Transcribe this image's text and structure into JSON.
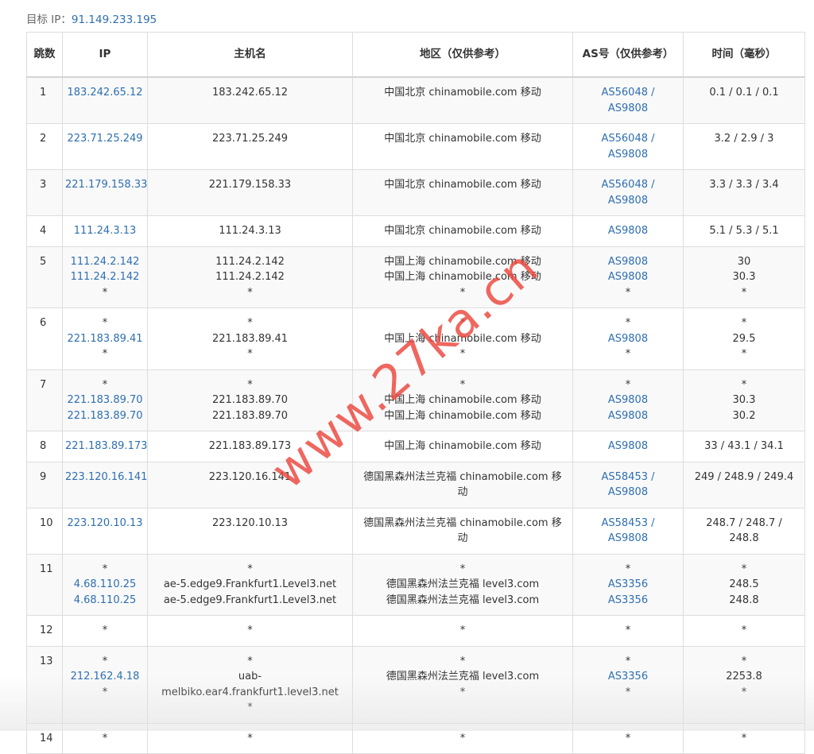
{
  "target": {
    "label": "目标 IP：",
    "ip": "91.149.233.195"
  },
  "headers": [
    "跳数",
    "IP",
    "主机名",
    "地区（仅供参考）",
    "AS号（仅供参考）",
    "时间（毫秒）"
  ],
  "rows": [
    {
      "hop": "1",
      "ip": [
        "183.242.65.12"
      ],
      "host": [
        "183.242.65.12"
      ],
      "region": [
        "中国北京 chinamobile.com 移动"
      ],
      "as": [
        "AS56048 /",
        "AS9808"
      ],
      "time": [
        "0.1 / 0.1 / 0.1"
      ]
    },
    {
      "hop": "2",
      "ip": [
        "223.71.25.249"
      ],
      "host": [
        "223.71.25.249"
      ],
      "region": [
        "中国北京 chinamobile.com 移动"
      ],
      "as": [
        "AS56048 /",
        "AS9808"
      ],
      "time": [
        "3.2 / 2.9 / 3"
      ]
    },
    {
      "hop": "3",
      "ip": [
        "221.179.158.33"
      ],
      "host": [
        "221.179.158.33"
      ],
      "region": [
        "中国北京 chinamobile.com 移动"
      ],
      "as": [
        "AS56048 /",
        "AS9808"
      ],
      "time": [
        "3.3 / 3.3 / 3.4"
      ]
    },
    {
      "hop": "4",
      "ip": [
        "111.24.3.13"
      ],
      "host": [
        "111.24.3.13"
      ],
      "region": [
        "中国北京 chinamobile.com 移动"
      ],
      "as": [
        "AS9808"
      ],
      "time": [
        "5.1 / 5.3 / 5.1"
      ]
    },
    {
      "hop": "5",
      "ip": [
        "111.24.2.142",
        "111.24.2.142",
        "*"
      ],
      "host": [
        "111.24.2.142",
        "111.24.2.142",
        "*"
      ],
      "region": [
        "中国上海 chinamobile.com 移动",
        "中国上海 chinamobile.com 移动",
        "*"
      ],
      "as": [
        "AS9808",
        "AS9808",
        "*"
      ],
      "time": [
        "30",
        "30.3",
        "*"
      ]
    },
    {
      "hop": "6",
      "ip": [
        "*",
        "221.183.89.41",
        "*"
      ],
      "host": [
        "*",
        "221.183.89.41",
        "*"
      ],
      "region": [
        "*",
        "中国上海 chinamobile.com 移动",
        "*"
      ],
      "as": [
        "*",
        "AS9808",
        "*"
      ],
      "time": [
        "*",
        "29.5",
        "*"
      ]
    },
    {
      "hop": "7",
      "ip": [
        "*",
        "221.183.89.70",
        "221.183.89.70"
      ],
      "host": [
        "*",
        "221.183.89.70",
        "221.183.89.70"
      ],
      "region": [
        "*",
        "中国上海 chinamobile.com 移动",
        "中国上海 chinamobile.com 移动"
      ],
      "as": [
        "*",
        "AS9808",
        "AS9808"
      ],
      "time": [
        "*",
        "30.3",
        "30.2"
      ]
    },
    {
      "hop": "8",
      "ip": [
        "221.183.89.173"
      ],
      "host": [
        "221.183.89.173"
      ],
      "region": [
        "中国上海 chinamobile.com 移动"
      ],
      "as": [
        "AS9808"
      ],
      "time": [
        "33 / 43.1 / 34.1"
      ]
    },
    {
      "hop": "9",
      "ip": [
        "223.120.16.141"
      ],
      "host": [
        "223.120.16.141"
      ],
      "region": [
        "德国黑森州法兰克福 chinamobile.com 移",
        "动"
      ],
      "as": [
        "AS58453 /",
        "AS9808"
      ],
      "time": [
        "249 / 248.9 / 249.4"
      ]
    },
    {
      "hop": "10",
      "ip": [
        "223.120.10.13"
      ],
      "host": [
        "223.120.10.13"
      ],
      "region": [
        "德国黑森州法兰克福 chinamobile.com 移",
        "动"
      ],
      "as": [
        "AS58453 /",
        "AS9808"
      ],
      "time": [
        "248.7 / 248.7 /",
        "248.8"
      ]
    },
    {
      "hop": "11",
      "ip": [
        "*",
        "4.68.110.25",
        "4.68.110.25"
      ],
      "host": [
        "*",
        "ae-5.edge9.Frankfurt1.Level3.net",
        "ae-5.edge9.Frankfurt1.Level3.net"
      ],
      "region": [
        "*",
        "德国黑森州法兰克福 level3.com",
        "德国黑森州法兰克福 level3.com"
      ],
      "as": [
        "*",
        "AS3356",
        "AS3356"
      ],
      "time": [
        "*",
        "248.5",
        "248.8"
      ]
    },
    {
      "hop": "12",
      "ip": [
        "*"
      ],
      "host": [
        "*"
      ],
      "region": [
        "*"
      ],
      "as": [
        "*"
      ],
      "time": [
        "*"
      ]
    },
    {
      "hop": "13",
      "ip": [
        "*",
        "212.162.4.18",
        "*"
      ],
      "host": [
        "*",
        "uab-",
        "melbiko.ear4.frankfurt1.level3.net",
        "*"
      ],
      "region": [
        "*",
        "德国黑森州法兰克福 level3.com",
        "*"
      ],
      "as": [
        "*",
        "AS3356",
        "*"
      ],
      "time": [
        "*",
        "2253.8",
        "*"
      ]
    },
    {
      "hop": "14",
      "ip": [
        "*"
      ],
      "host": [
        "*"
      ],
      "region": [
        "*"
      ],
      "as": [
        "*"
      ],
      "time": [
        "*"
      ]
    }
  ],
  "watermark": "www.27ka.cn"
}
